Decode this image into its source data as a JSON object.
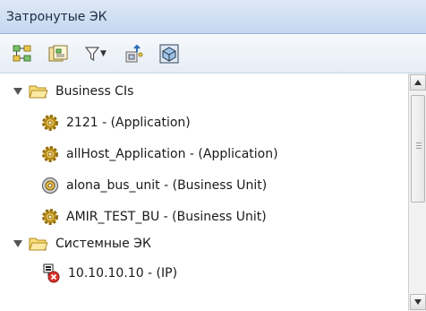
{
  "panel": {
    "title": "Затронутые ЭК"
  },
  "toolbar": {
    "buttons": [
      {
        "icon": "tree-layout-icon"
      },
      {
        "icon": "properties-icon"
      },
      {
        "icon": "filter-icon"
      },
      {
        "icon": "import-icon"
      },
      {
        "icon": "cube-view-icon"
      }
    ]
  },
  "tree": {
    "groups": [
      {
        "label": "Business CIs",
        "expanded": true,
        "items": [
          {
            "label": "2121 - (Application)",
            "icon": "gear-icon"
          },
          {
            "label": "allHost_Application - (Application)",
            "icon": "gear-icon"
          },
          {
            "label": "alona_bus_unit - (Business Unit)",
            "icon": "business-unit-icon"
          },
          {
            "label": "AMIR_TEST_BU - (Business Unit)",
            "icon": "gear-icon"
          }
        ]
      },
      {
        "label": "Системные ЭК",
        "expanded": true,
        "items": [
          {
            "label": "10.10.10.10 - (IP)",
            "icon": "ip-error-icon"
          }
        ]
      }
    ]
  },
  "colors": {
    "titlebar": "#c4d6ee",
    "folder": "#f2c94c",
    "gear": "#d9a825"
  }
}
